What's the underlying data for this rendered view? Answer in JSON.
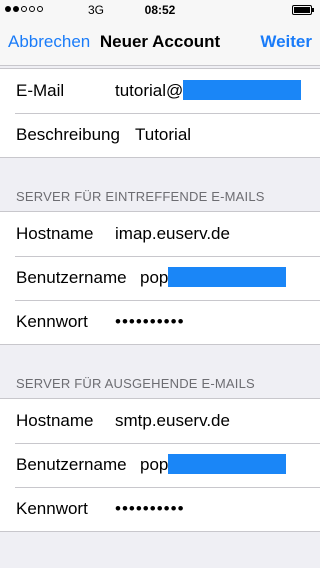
{
  "statusbar": {
    "carrier": "3G",
    "time": "08:52"
  },
  "navbar": {
    "cancel": "Abbrechen",
    "title": "Neuer Account",
    "next": "Weiter"
  },
  "account": {
    "email_label": "E-Mail",
    "email_value": "tutorial@",
    "description_label": "Beschreibung",
    "description_value": "Tutorial"
  },
  "incoming": {
    "header": "SERVER FÜR EINTREFFENDE E-MAILS",
    "hostname_label": "Hostname",
    "hostname_value": "imap.euserv.de",
    "username_label": "Benutzername",
    "username_value": "pop",
    "password_label": "Kennwort",
    "password_value": "••••••••••"
  },
  "outgoing": {
    "header": "SERVER FÜR AUSGEHENDE E-MAILS",
    "hostname_label": "Hostname",
    "hostname_value": "smtp.euserv.de",
    "username_label": "Benutzername",
    "username_value": "pop",
    "password_label": "Kennwort",
    "password_value": "••••••••••"
  },
  "colors": {
    "accent": "#1a7cf9",
    "redaction": "#1a86f7",
    "background": "#efeff4"
  }
}
